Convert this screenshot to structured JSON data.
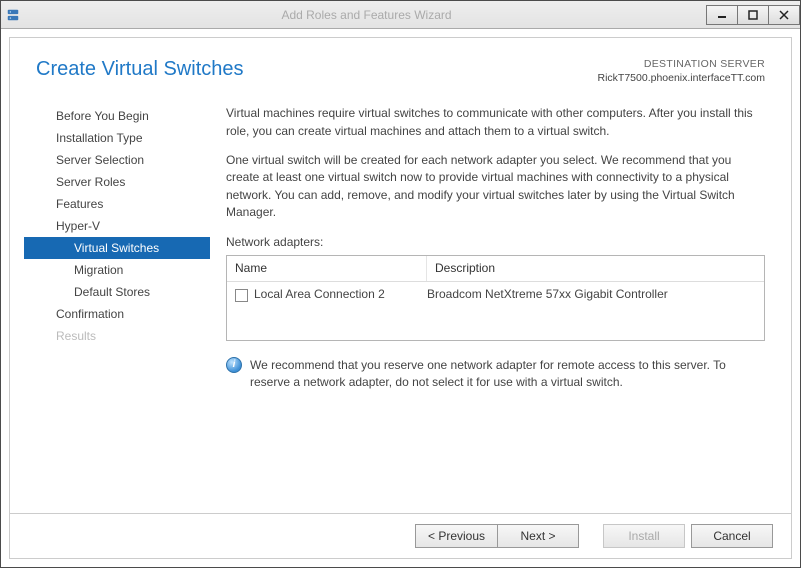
{
  "window": {
    "title": "Add Roles and Features Wizard"
  },
  "header": {
    "page_title": "Create Virtual Switches",
    "destination_label": "DESTINATION SERVER",
    "destination_server": "RickT7500.phoenix.interfaceTT.com"
  },
  "nav": {
    "items": [
      {
        "label": "Before You Begin"
      },
      {
        "label": "Installation Type"
      },
      {
        "label": "Server Selection"
      },
      {
        "label": "Server Roles"
      },
      {
        "label": "Features"
      },
      {
        "label": "Hyper-V"
      },
      {
        "label": "Virtual Switches"
      },
      {
        "label": "Migration"
      },
      {
        "label": "Default Stores"
      },
      {
        "label": "Confirmation"
      },
      {
        "label": "Results"
      }
    ]
  },
  "body": {
    "paragraph1": "Virtual machines require virtual switches to communicate with other computers. After you install this role, you can create virtual machines and attach them to a virtual switch.",
    "paragraph2": "One virtual switch will be created for each network adapter you select. We recommend that you create at least one virtual switch now to provide virtual machines with connectivity to a physical network. You can add, remove, and modify your virtual switches later by using the Virtual Switch Manager.",
    "adapters_label": "Network adapters:",
    "table": {
      "col_name": "Name",
      "col_desc": "Description",
      "rows": [
        {
          "name": "Local Area Connection 2",
          "desc": "Broadcom NetXtreme 57xx Gigabit Controller",
          "checked": false
        }
      ]
    },
    "note": "We recommend that you reserve one network adapter for remote access to this server. To reserve a network adapter, do not select it for use with a virtual switch."
  },
  "footer": {
    "previous": "< Previous",
    "next": "Next >",
    "install": "Install",
    "cancel": "Cancel"
  }
}
